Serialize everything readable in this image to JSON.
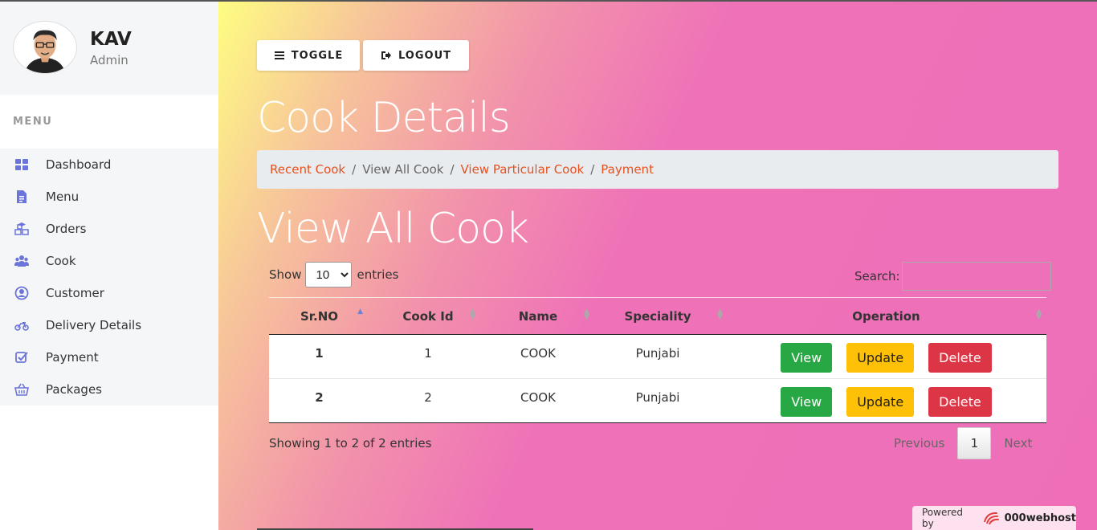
{
  "profile": {
    "name": "KAV",
    "role": "Admin"
  },
  "menu": {
    "header": "MENU",
    "items": [
      {
        "label": "Dashboard",
        "icon": "grid-icon"
      },
      {
        "label": "Menu",
        "icon": "document-icon"
      },
      {
        "label": "Orders",
        "icon": "cubes-icon"
      },
      {
        "label": "Cook",
        "icon": "users-icon"
      },
      {
        "label": "Customer",
        "icon": "user-circle-icon"
      },
      {
        "label": "Delivery Details",
        "icon": "motorcycle-icon"
      },
      {
        "label": "Payment",
        "icon": "check-square-icon"
      },
      {
        "label": "Packages",
        "icon": "basket-icon"
      }
    ]
  },
  "toolbar": {
    "toggle_label": "TOGGLE",
    "logout_label": "LOGOUT"
  },
  "page_title": "Cook Details",
  "breadcrumb": {
    "items": [
      "Recent Cook",
      "View All Cook",
      "View Particular Cook",
      "Payment"
    ],
    "separator": "/"
  },
  "section_title": "View All Cook",
  "datatable": {
    "show_label": "Show",
    "entries_label": "entries",
    "page_size": "10",
    "search_label": "Search:",
    "search_value": "",
    "columns": [
      "Sr.NO",
      "Cook Id",
      "Name",
      "Speciality",
      "Operation"
    ],
    "rows": [
      {
        "sr": "1",
        "cook_id": "1",
        "name": "COOK",
        "speciality": "Punjabi"
      },
      {
        "sr": "2",
        "cook_id": "2",
        "name": "COOK",
        "speciality": "Punjabi"
      }
    ],
    "op_view": "View",
    "op_update": "Update",
    "op_delete": "Delete",
    "info": "Showing 1 to 2 of 2 entries",
    "pager": {
      "previous": "Previous",
      "current": "1",
      "next": "Next"
    }
  },
  "powered": {
    "label": "Powered by",
    "brand": "000webhost"
  },
  "colors": {
    "accent_link": "#e8501f",
    "view": "#28a745",
    "update": "#ffc107",
    "delete": "#dc3545",
    "menu_icon": "#6b74d8"
  }
}
